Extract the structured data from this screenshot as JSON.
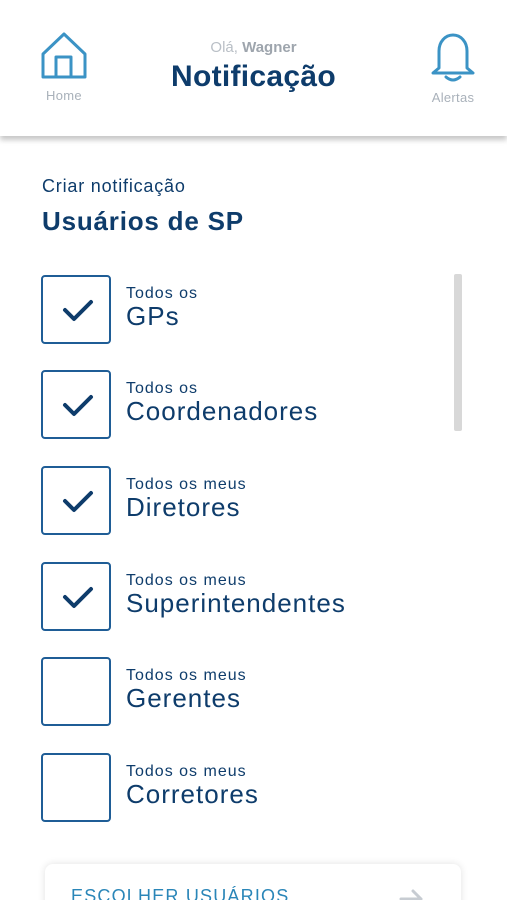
{
  "header": {
    "home_label": "Home",
    "alerts_label": "Alertas",
    "greeting_prefix": "Olá,",
    "user_name": "Wagner",
    "title": "Notificação"
  },
  "main": {
    "subtitle": "Criar notificação",
    "section_title": "Usuários de SP",
    "options": [
      {
        "prefix": "Todos os",
        "label": "GPs",
        "checked": true
      },
      {
        "prefix": "Todos os",
        "label": "Coordenadores",
        "checked": true
      },
      {
        "prefix": "Todos os meus",
        "label": "Diretores",
        "checked": true
      },
      {
        "prefix": "Todos os meus",
        "label": "Superintendentes",
        "checked": true
      },
      {
        "prefix": "Todos os meus",
        "label": "Gerentes",
        "checked": false
      },
      {
        "prefix": "Todos os meus",
        "label": "Corretores",
        "checked": false
      }
    ],
    "choose_users_label": "ESCOLHER USUÁRIOS"
  },
  "colors": {
    "primary": "#0e3c6b",
    "accent": "#2a86b8",
    "icon": "#3b93c5",
    "muted": "#a9b1ba"
  },
  "icons": [
    "home-icon",
    "bell-icon",
    "check-icon",
    "arrow-right-icon"
  ]
}
